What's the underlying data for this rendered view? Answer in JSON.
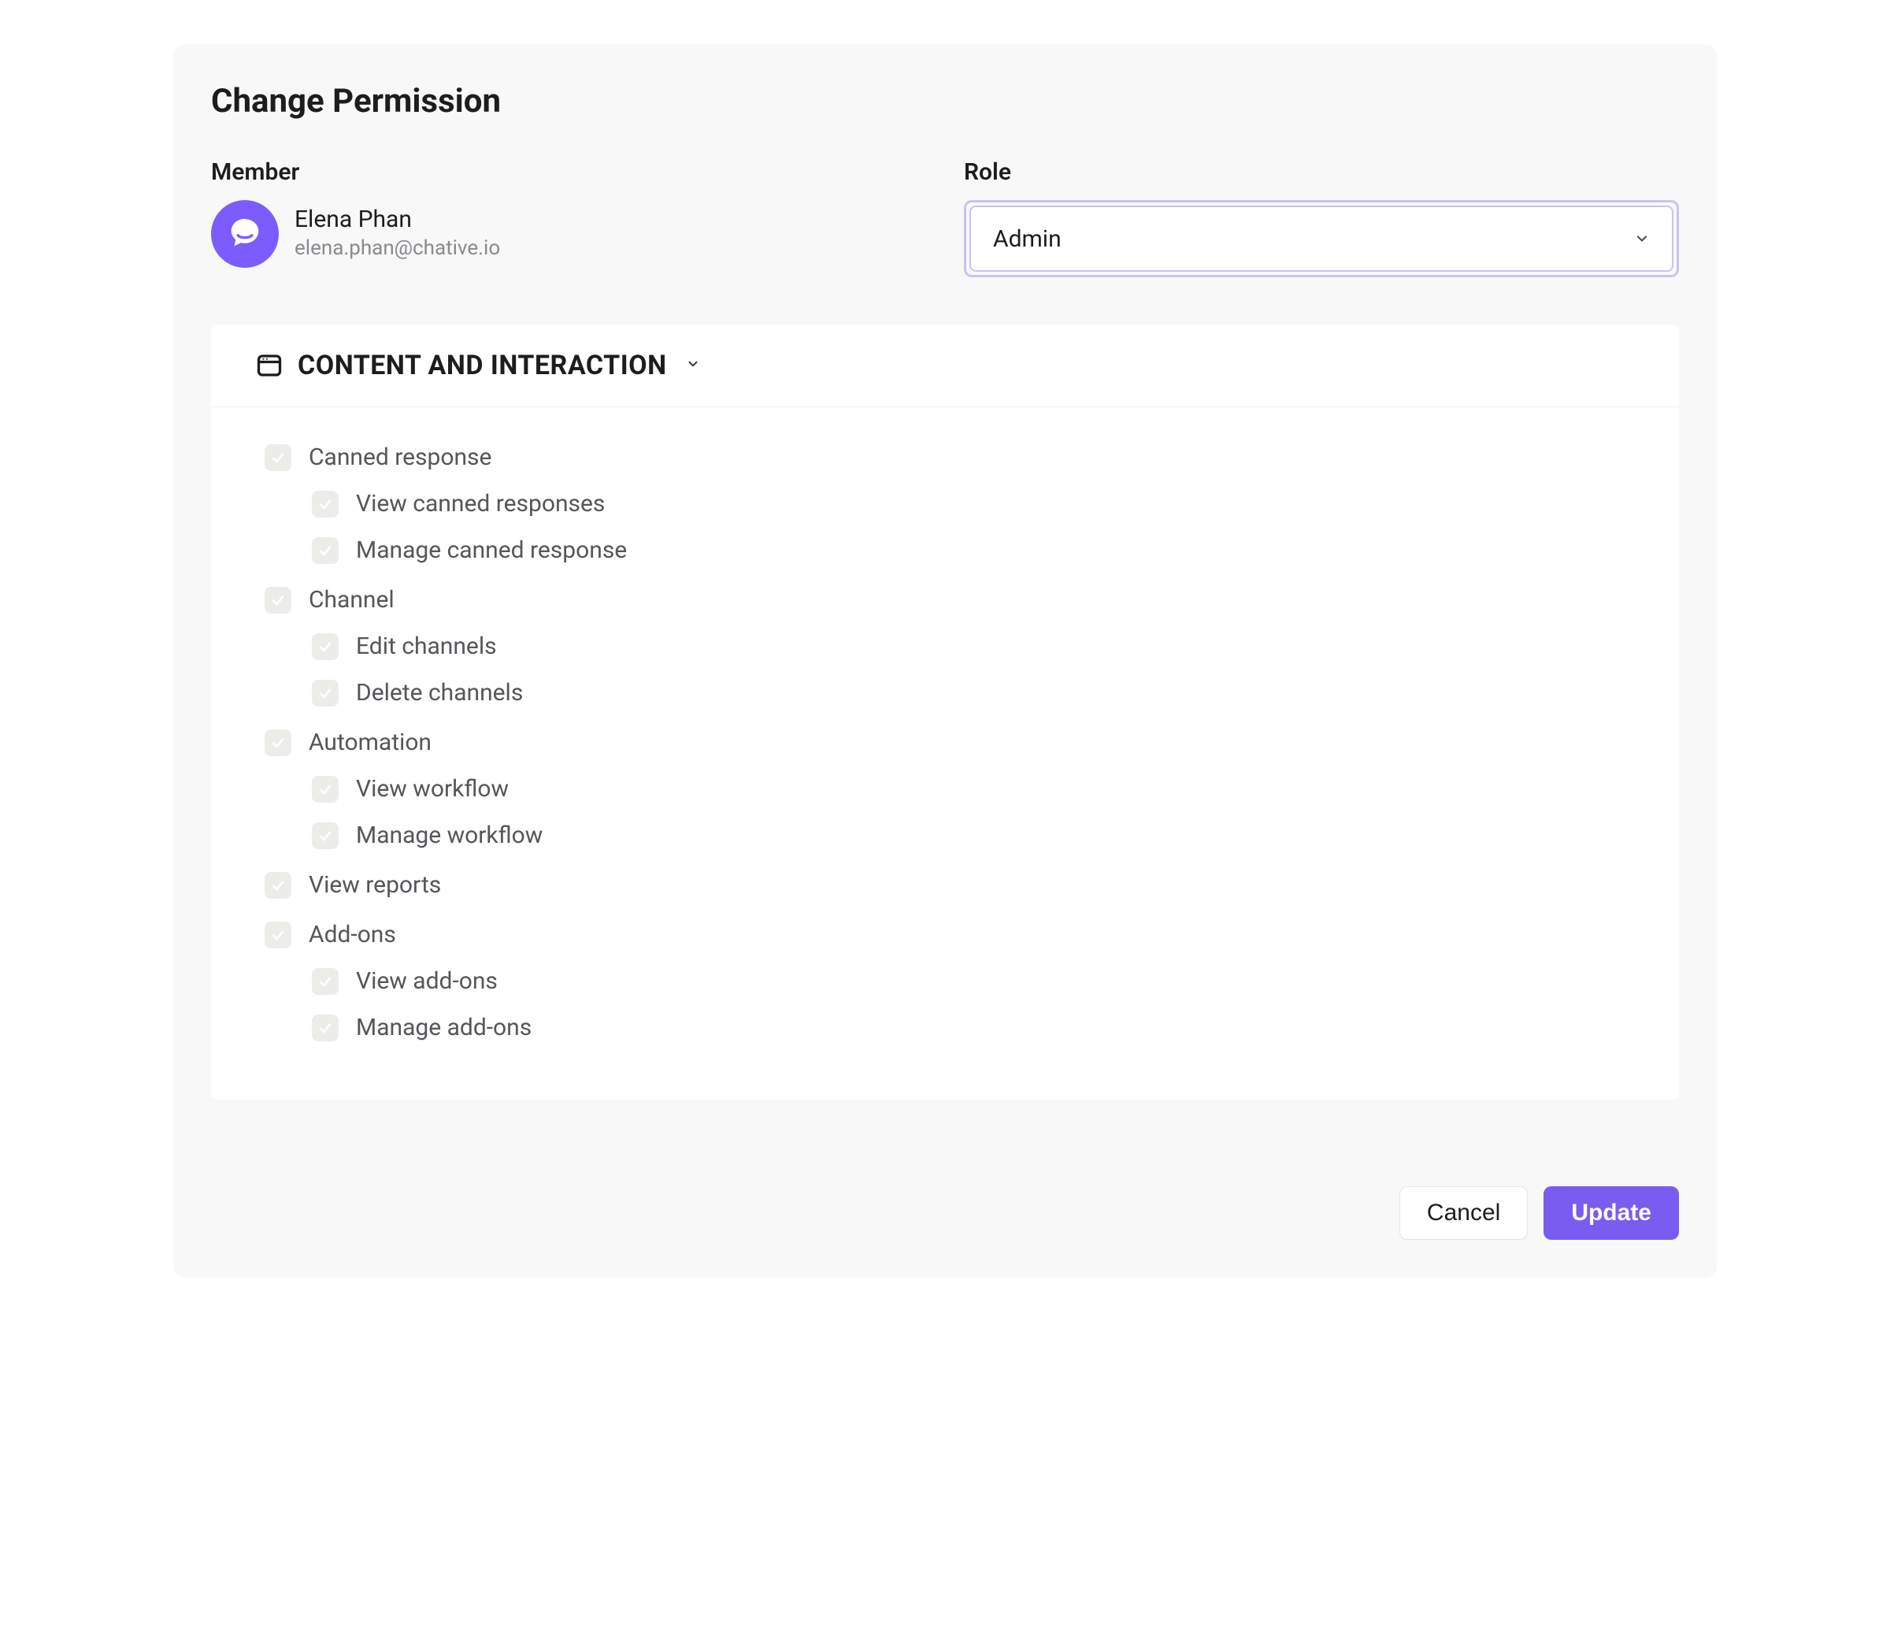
{
  "title": "Change Permission",
  "member": {
    "label": "Member",
    "name": "Elena Phan",
    "email": "elena.phan@chative.io"
  },
  "role": {
    "label": "Role",
    "selected": "Admin"
  },
  "section": {
    "title": "CONTENT AND INTERACTION"
  },
  "permissions": [
    {
      "label": "Canned response",
      "level": 0,
      "checked": true
    },
    {
      "label": "View canned responses",
      "level": 1,
      "checked": true
    },
    {
      "label": "Manage canned response",
      "level": 1,
      "checked": true
    },
    {
      "label": "Channel",
      "level": 0,
      "checked": true
    },
    {
      "label": "Edit channels",
      "level": 1,
      "checked": true
    },
    {
      "label": "Delete channels",
      "level": 1,
      "checked": true
    },
    {
      "label": "Automation",
      "level": 0,
      "checked": true
    },
    {
      "label": "View workflow",
      "level": 1,
      "checked": true
    },
    {
      "label": "Manage workflow",
      "level": 1,
      "checked": true
    },
    {
      "label": "View reports",
      "level": 0,
      "checked": true
    },
    {
      "label": "Add-ons",
      "level": 0,
      "checked": true
    },
    {
      "label": "View add-ons",
      "level": 1,
      "checked": true
    },
    {
      "label": "Manage add-ons",
      "level": 1,
      "checked": true
    }
  ],
  "buttons": {
    "cancel": "Cancel",
    "update": "Update"
  },
  "colors": {
    "accent": "#7a5cf0",
    "avatar": "#7c5cff",
    "panel_bg": "#f8f8f9",
    "muted_text": "#55555a"
  }
}
